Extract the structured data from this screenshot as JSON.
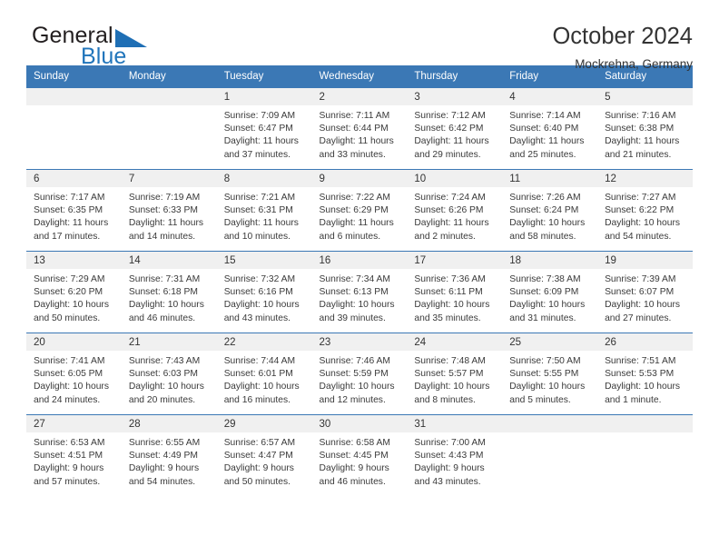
{
  "brand": {
    "name_top": "General",
    "name_bottom": "Blue",
    "triangle_color": "#1f6fb5"
  },
  "header": {
    "title": "October 2024",
    "subtitle": "Mockrehna, Germany",
    "accent_color": "#3b78b5",
    "daynum_band_color": "#f0f0f0"
  },
  "calendar": {
    "weekday_headers": [
      "Sunday",
      "Monday",
      "Tuesday",
      "Wednesday",
      "Thursday",
      "Friday",
      "Saturday"
    ],
    "labels": {
      "sunrise": "Sunrise:",
      "sunset": "Sunset:",
      "daylight": "Daylight:"
    },
    "weeks": [
      [
        {
          "day": ""
        },
        {
          "day": ""
        },
        {
          "day": "1",
          "sunrise": "Sunrise: 7:09 AM",
          "sunset": "Sunset: 6:47 PM",
          "daylight_1": "Daylight: 11 hours",
          "daylight_2": "and 37 minutes."
        },
        {
          "day": "2",
          "sunrise": "Sunrise: 7:11 AM",
          "sunset": "Sunset: 6:44 PM",
          "daylight_1": "Daylight: 11 hours",
          "daylight_2": "and 33 minutes."
        },
        {
          "day": "3",
          "sunrise": "Sunrise: 7:12 AM",
          "sunset": "Sunset: 6:42 PM",
          "daylight_1": "Daylight: 11 hours",
          "daylight_2": "and 29 minutes."
        },
        {
          "day": "4",
          "sunrise": "Sunrise: 7:14 AM",
          "sunset": "Sunset: 6:40 PM",
          "daylight_1": "Daylight: 11 hours",
          "daylight_2": "and 25 minutes."
        },
        {
          "day": "5",
          "sunrise": "Sunrise: 7:16 AM",
          "sunset": "Sunset: 6:38 PM",
          "daylight_1": "Daylight: 11 hours",
          "daylight_2": "and 21 minutes."
        }
      ],
      [
        {
          "day": "6",
          "sunrise": "Sunrise: 7:17 AM",
          "sunset": "Sunset: 6:35 PM",
          "daylight_1": "Daylight: 11 hours",
          "daylight_2": "and 17 minutes."
        },
        {
          "day": "7",
          "sunrise": "Sunrise: 7:19 AM",
          "sunset": "Sunset: 6:33 PM",
          "daylight_1": "Daylight: 11 hours",
          "daylight_2": "and 14 minutes."
        },
        {
          "day": "8",
          "sunrise": "Sunrise: 7:21 AM",
          "sunset": "Sunset: 6:31 PM",
          "daylight_1": "Daylight: 11 hours",
          "daylight_2": "and 10 minutes."
        },
        {
          "day": "9",
          "sunrise": "Sunrise: 7:22 AM",
          "sunset": "Sunset: 6:29 PM",
          "daylight_1": "Daylight: 11 hours",
          "daylight_2": "and 6 minutes."
        },
        {
          "day": "10",
          "sunrise": "Sunrise: 7:24 AM",
          "sunset": "Sunset: 6:26 PM",
          "daylight_1": "Daylight: 11 hours",
          "daylight_2": "and 2 minutes."
        },
        {
          "day": "11",
          "sunrise": "Sunrise: 7:26 AM",
          "sunset": "Sunset: 6:24 PM",
          "daylight_1": "Daylight: 10 hours",
          "daylight_2": "and 58 minutes."
        },
        {
          "day": "12",
          "sunrise": "Sunrise: 7:27 AM",
          "sunset": "Sunset: 6:22 PM",
          "daylight_1": "Daylight: 10 hours",
          "daylight_2": "and 54 minutes."
        }
      ],
      [
        {
          "day": "13",
          "sunrise": "Sunrise: 7:29 AM",
          "sunset": "Sunset: 6:20 PM",
          "daylight_1": "Daylight: 10 hours",
          "daylight_2": "and 50 minutes."
        },
        {
          "day": "14",
          "sunrise": "Sunrise: 7:31 AM",
          "sunset": "Sunset: 6:18 PM",
          "daylight_1": "Daylight: 10 hours",
          "daylight_2": "and 46 minutes."
        },
        {
          "day": "15",
          "sunrise": "Sunrise: 7:32 AM",
          "sunset": "Sunset: 6:16 PM",
          "daylight_1": "Daylight: 10 hours",
          "daylight_2": "and 43 minutes."
        },
        {
          "day": "16",
          "sunrise": "Sunrise: 7:34 AM",
          "sunset": "Sunset: 6:13 PM",
          "daylight_1": "Daylight: 10 hours",
          "daylight_2": "and 39 minutes."
        },
        {
          "day": "17",
          "sunrise": "Sunrise: 7:36 AM",
          "sunset": "Sunset: 6:11 PM",
          "daylight_1": "Daylight: 10 hours",
          "daylight_2": "and 35 minutes."
        },
        {
          "day": "18",
          "sunrise": "Sunrise: 7:38 AM",
          "sunset": "Sunset: 6:09 PM",
          "daylight_1": "Daylight: 10 hours",
          "daylight_2": "and 31 minutes."
        },
        {
          "day": "19",
          "sunrise": "Sunrise: 7:39 AM",
          "sunset": "Sunset: 6:07 PM",
          "daylight_1": "Daylight: 10 hours",
          "daylight_2": "and 27 minutes."
        }
      ],
      [
        {
          "day": "20",
          "sunrise": "Sunrise: 7:41 AM",
          "sunset": "Sunset: 6:05 PM",
          "daylight_1": "Daylight: 10 hours",
          "daylight_2": "and 24 minutes."
        },
        {
          "day": "21",
          "sunrise": "Sunrise: 7:43 AM",
          "sunset": "Sunset: 6:03 PM",
          "daylight_1": "Daylight: 10 hours",
          "daylight_2": "and 20 minutes."
        },
        {
          "day": "22",
          "sunrise": "Sunrise: 7:44 AM",
          "sunset": "Sunset: 6:01 PM",
          "daylight_1": "Daylight: 10 hours",
          "daylight_2": "and 16 minutes."
        },
        {
          "day": "23",
          "sunrise": "Sunrise: 7:46 AM",
          "sunset": "Sunset: 5:59 PM",
          "daylight_1": "Daylight: 10 hours",
          "daylight_2": "and 12 minutes."
        },
        {
          "day": "24",
          "sunrise": "Sunrise: 7:48 AM",
          "sunset": "Sunset: 5:57 PM",
          "daylight_1": "Daylight: 10 hours",
          "daylight_2": "and 8 minutes."
        },
        {
          "day": "25",
          "sunrise": "Sunrise: 7:50 AM",
          "sunset": "Sunset: 5:55 PM",
          "daylight_1": "Daylight: 10 hours",
          "daylight_2": "and 5 minutes."
        },
        {
          "day": "26",
          "sunrise": "Sunrise: 7:51 AM",
          "sunset": "Sunset: 5:53 PM",
          "daylight_1": "Daylight: 10 hours",
          "daylight_2": "and 1 minute."
        }
      ],
      [
        {
          "day": "27",
          "sunrise": "Sunrise: 6:53 AM",
          "sunset": "Sunset: 4:51 PM",
          "daylight_1": "Daylight: 9 hours",
          "daylight_2": "and 57 minutes."
        },
        {
          "day": "28",
          "sunrise": "Sunrise: 6:55 AM",
          "sunset": "Sunset: 4:49 PM",
          "daylight_1": "Daylight: 9 hours",
          "daylight_2": "and 54 minutes."
        },
        {
          "day": "29",
          "sunrise": "Sunrise: 6:57 AM",
          "sunset": "Sunset: 4:47 PM",
          "daylight_1": "Daylight: 9 hours",
          "daylight_2": "and 50 minutes."
        },
        {
          "day": "30",
          "sunrise": "Sunrise: 6:58 AM",
          "sunset": "Sunset: 4:45 PM",
          "daylight_1": "Daylight: 9 hours",
          "daylight_2": "and 46 minutes."
        },
        {
          "day": "31",
          "sunrise": "Sunrise: 7:00 AM",
          "sunset": "Sunset: 4:43 PM",
          "daylight_1": "Daylight: 9 hours",
          "daylight_2": "and 43 minutes."
        },
        {
          "day": ""
        },
        {
          "day": ""
        }
      ]
    ]
  }
}
